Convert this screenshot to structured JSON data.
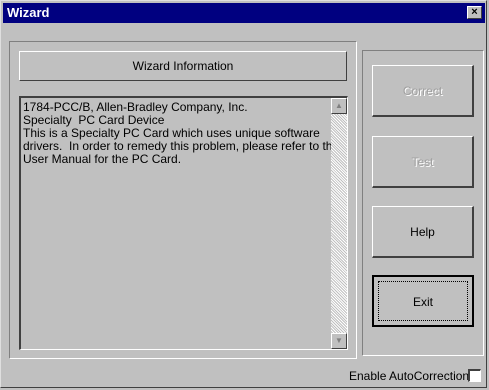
{
  "window": {
    "title": "Wizard",
    "close_glyph": "×"
  },
  "info_panel": {
    "header": "Wizard Information",
    "lines": [
      "1784-PCC/B, Allen-Bradley Company, Inc.",
      "Specialty  PC Card Device",
      "",
      "This is a Specialty PC Card which uses unique software",
      "drivers.  In order to remedy this problem, please refer to the",
      "User Manual for the PC Card."
    ],
    "scroll_up_glyph": "▲",
    "scroll_down_glyph": "▼"
  },
  "buttons": {
    "correct": "Correct",
    "test": "Test",
    "help": "Help",
    "exit": "Exit"
  },
  "auto_correction": {
    "label": "Enable AutoCorrection",
    "checked": false
  }
}
